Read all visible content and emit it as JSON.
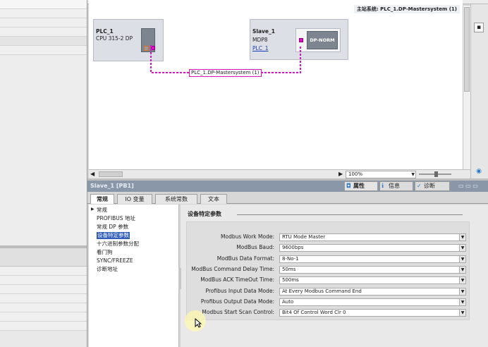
{
  "master_system": {
    "label": "主站系统: PLC_1.DP-Mastersystem (1)"
  },
  "plc": {
    "name": "PLC_1",
    "type": "CPU 315-2 DP"
  },
  "slave": {
    "name": "Slave_1",
    "type": "MDP8",
    "link": "PLC_1",
    "module_label": "DP-NORM"
  },
  "bus_label": "PLC_1.DP-Mastersystem (1)",
  "zoom": {
    "value": "100%"
  },
  "properties": {
    "title": "Slave_1 [PB1]",
    "right_tabs": [
      {
        "label": "属性"
      },
      {
        "label": "信息"
      },
      {
        "label": "诊断"
      }
    ],
    "tabs": [
      {
        "label": "常规"
      },
      {
        "label": "IO 变量"
      },
      {
        "label": "系统常数"
      },
      {
        "label": "文本"
      }
    ],
    "nav": [
      {
        "label": "常规"
      },
      {
        "label": "PROFIBUS 地址"
      },
      {
        "label": "常规 DP 参数"
      },
      {
        "label": "设备特定参数"
      },
      {
        "label": "十六进制参数分配"
      },
      {
        "label": "看门狗"
      },
      {
        "label": "SYNC/FREEZE"
      },
      {
        "label": "诊断地址"
      }
    ],
    "section_title": "设备特定参数",
    "params": [
      {
        "label": "Modbus Work Mode:",
        "value": "RTU Mode Master"
      },
      {
        "label": "ModBus Baud:",
        "value": "9600bps"
      },
      {
        "label": "ModBus Data Format:",
        "value": "8-No-1"
      },
      {
        "label": "ModBus Command Delay Time:",
        "value": "50ms"
      },
      {
        "label": "ModBus ACK TimeOut Time:",
        "value": "500ms"
      },
      {
        "label": "Profibus Input Data Mode:",
        "value": "At Every Modbus Command End"
      },
      {
        "label": "Profibus Output Data Mode:",
        "value": "Auto"
      },
      {
        "label": "Modbus Start Scan Control:",
        "value": "Bit4 Of Control Word Clr 0"
      }
    ]
  },
  "colors": {
    "accent": "#e010c8",
    "title_bar": "#8a97a8",
    "selected": "#2e5cb8"
  }
}
